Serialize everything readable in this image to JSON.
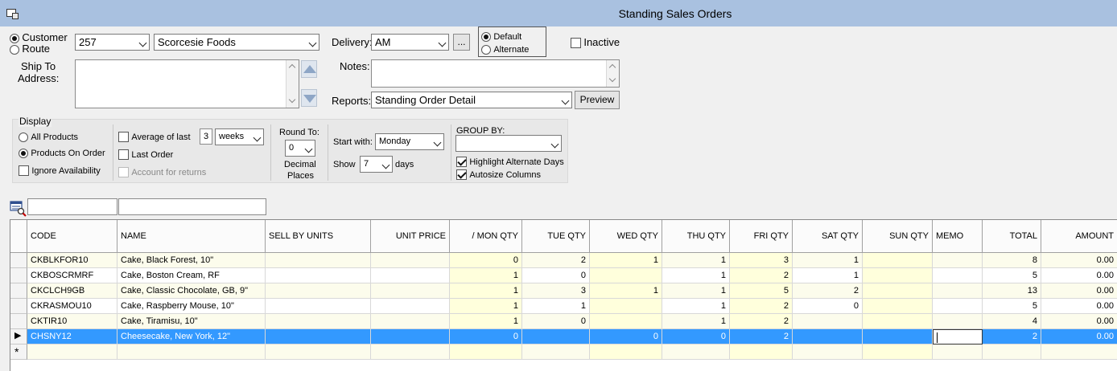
{
  "window": {
    "title": "Standing Sales Orders"
  },
  "mode": {
    "customer_label": "Customer",
    "route_label": "Route",
    "selected": "customer"
  },
  "customer": {
    "code": "257",
    "name": "Scorcesie Foods"
  },
  "ship_to": {
    "label_line1": "Ship To",
    "label_line2": "Address:",
    "value": ""
  },
  "delivery": {
    "label": "Delivery:",
    "value": "AM",
    "browse_label": "..."
  },
  "delivery_type": {
    "default_label": "Default",
    "alternate_label": "Alternate",
    "selected": "default"
  },
  "inactive": {
    "label": "Inactive",
    "checked": false
  },
  "notes": {
    "label": "Notes:",
    "value": ""
  },
  "reports": {
    "label": "Reports:",
    "value": "Standing Order Detail",
    "preview_label": "Preview"
  },
  "display": {
    "group_label": "Display",
    "all_products_label": "All Products",
    "products_on_order_label": "Products On Order",
    "selected": "products_on_order",
    "ignore_availability_label": "Ignore Availability",
    "ignore_availability_checked": false,
    "average_of_last_label": "Average of last",
    "average_of_last_checked": false,
    "average_count": "3",
    "average_unit": "weeks",
    "last_order_label": "Last Order",
    "last_order_checked": false,
    "account_for_returns_label": "Account for returns",
    "account_for_returns_checked": false,
    "round_to_label": "Round To:",
    "round_to_value": "0",
    "decimal_label_line1": "Decimal",
    "decimal_label_line2": "Places",
    "start_with_label": "Start with:",
    "start_with_value": "Monday",
    "show_label": "Show",
    "show_value": "7",
    "days_label": "days",
    "group_by_label": "GROUP BY:",
    "group_by_value": "",
    "highlight_alternate_label": "Highlight Alternate Days",
    "highlight_alternate_checked": true,
    "autosize_columns_label": "Autosize Columns",
    "autosize_columns_checked": true
  },
  "filters": {
    "code_filter": "",
    "name_filter": ""
  },
  "grid": {
    "columns": [
      "CODE",
      "NAME",
      "SELL BY UNITS",
      "UNIT PRICE",
      "/  MON QTY",
      "TUE QTY",
      "WED QTY",
      "THU QTY",
      "FRI QTY",
      "SAT QTY",
      "SUN QTY",
      "MEMO",
      "TOTAL",
      "AMOUNT"
    ],
    "rows": [
      [
        "CKBLKFOR10",
        "Cake, Black Forest, 10\"",
        "",
        "",
        "0",
        "2",
        "1",
        "1",
        "3",
        "1",
        "",
        "",
        "8",
        "0.00"
      ],
      [
        "CKBOSCRMRF",
        "Cake, Boston Cream, RF",
        "",
        "",
        "1",
        "0",
        "",
        "1",
        "2",
        "1",
        "",
        "",
        "5",
        "0.00"
      ],
      [
        "CKCLCH9GB",
        "Cake, Classic Chocolate, GB, 9\"",
        "",
        "",
        "1",
        "3",
        "1",
        "1",
        "5",
        "2",
        "",
        "",
        "13",
        "0.00"
      ],
      [
        "CKRASMOU10",
        "Cake, Raspberry Mouse, 10\"",
        "",
        "",
        "1",
        "1",
        "",
        "1",
        "2",
        "0",
        "",
        "",
        "5",
        "0.00"
      ],
      [
        "CKTIR10",
        "Cake, Tiramisu, 10\"",
        "",
        "",
        "1",
        "0",
        "",
        "1",
        "2",
        "",
        "",
        "",
        "4",
        "0.00"
      ],
      [
        "CHSNY12",
        "Cheesecake, New York, 12\"",
        "",
        "",
        "0",
        "",
        "0",
        "0",
        "2",
        "",
        "",
        "",
        "2",
        "0.00"
      ]
    ],
    "selected_row": 5,
    "new_row_marker": "*",
    "current_row_marker": "▶",
    "colors": {
      "selected": "#3399ff",
      "highlight": "#ffffdc",
      "alt_row": "#fcfcec"
    }
  }
}
